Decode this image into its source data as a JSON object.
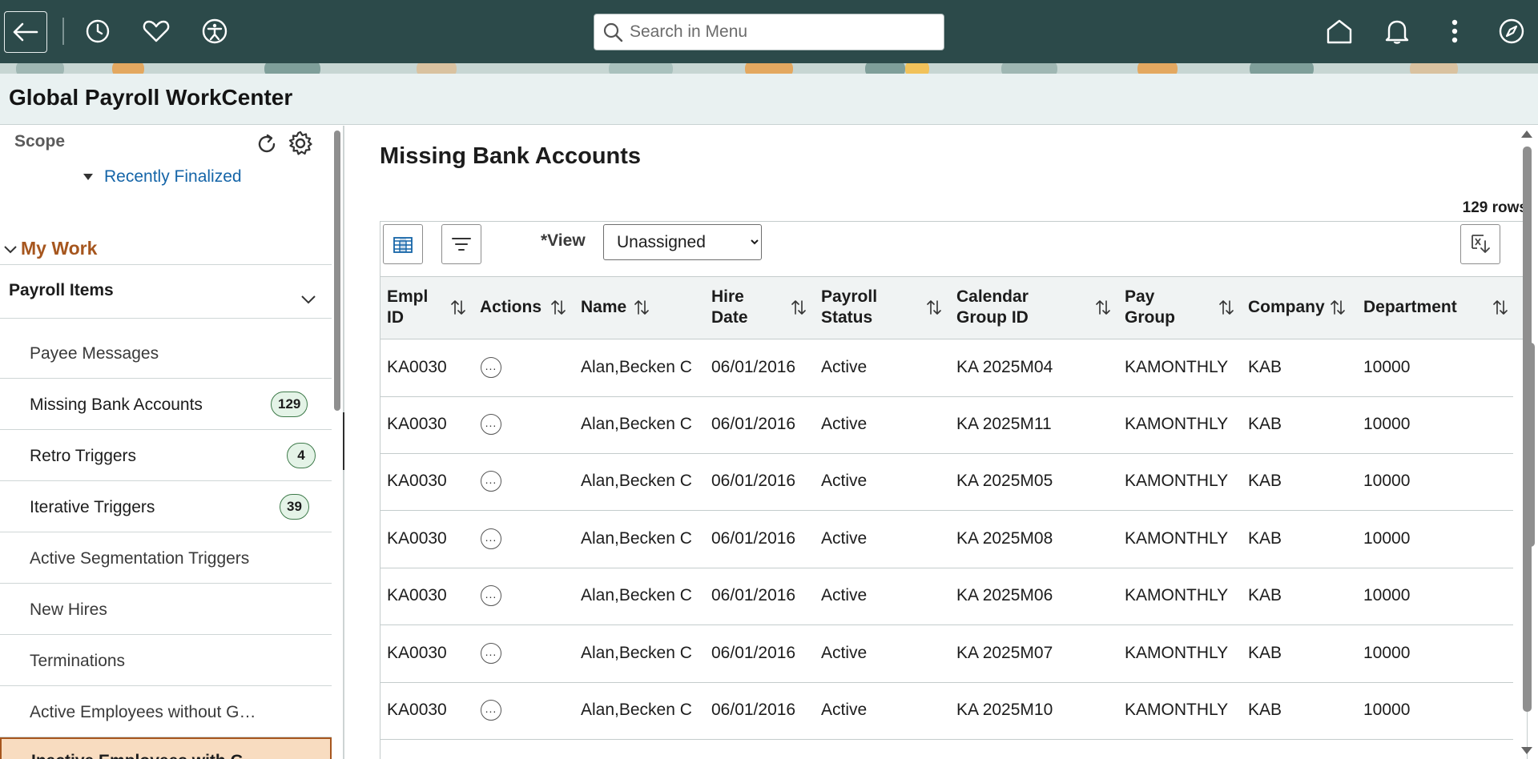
{
  "header": {
    "search_placeholder": "Search in Menu",
    "icons": [
      "back-icon",
      "history-icon",
      "favorites-icon",
      "accessibility-icon",
      "search-icon",
      "home-icon",
      "notifications-icon",
      "more-icon",
      "navigator-icon"
    ]
  },
  "page": {
    "title": "Global Payroll WorkCenter"
  },
  "left_panel": {
    "scope_label": "Scope",
    "recently_finalized": "Recently Finalized",
    "my_work": "My Work",
    "payroll_items": "Payroll Items",
    "items": [
      {
        "label": "Payee Messages",
        "badge": ""
      },
      {
        "label": "Missing Bank Accounts",
        "badge": "129"
      },
      {
        "label": "Retro Triggers",
        "badge": "4"
      },
      {
        "label": "Iterative Triggers",
        "badge": "39"
      },
      {
        "label": "Active Segmentation Triggers",
        "badge": ""
      },
      {
        "label": "New Hires",
        "badge": ""
      },
      {
        "label": "Terminations",
        "badge": ""
      },
      {
        "label": "Active Employees without G…",
        "badge": ""
      },
      {
        "label": "Inactive Employees with G…",
        "badge": ""
      }
    ]
  },
  "main": {
    "title": "Missing Bank Accounts",
    "row_count": "129 rows",
    "view_label": "*View",
    "view_value": "Unassigned",
    "columns": [
      {
        "line1": "Empl",
        "line2": "ID"
      },
      {
        "line1": "Actions",
        "line2": ""
      },
      {
        "line1": "Name",
        "line2": ""
      },
      {
        "line1": "Hire",
        "line2": "Date"
      },
      {
        "line1": "Payroll",
        "line2": "Status"
      },
      {
        "line1": "Calendar",
        "line2": "Group ID"
      },
      {
        "line1": "Pay",
        "line2": "Group"
      },
      {
        "line1": "Company",
        "line2": ""
      },
      {
        "line1": "Department",
        "line2": ""
      }
    ],
    "rows": [
      {
        "emplid": "KA0030",
        "name": "Alan,Becken C",
        "hire_date": "06/01/2016",
        "status": "Active",
        "cal_group": "KA 2025M04",
        "pay_group": "KAMONTHLY",
        "company": "KAB",
        "department": "10000"
      },
      {
        "emplid": "KA0030",
        "name": "Alan,Becken C",
        "hire_date": "06/01/2016",
        "status": "Active",
        "cal_group": "KA 2025M11",
        "pay_group": "KAMONTHLY",
        "company": "KAB",
        "department": "10000"
      },
      {
        "emplid": "KA0030",
        "name": "Alan,Becken C",
        "hire_date": "06/01/2016",
        "status": "Active",
        "cal_group": "KA 2025M05",
        "pay_group": "KAMONTHLY",
        "company": "KAB",
        "department": "10000"
      },
      {
        "emplid": "KA0030",
        "name": "Alan,Becken C",
        "hire_date": "06/01/2016",
        "status": "Active",
        "cal_group": "KA 2025M08",
        "pay_group": "KAMONTHLY",
        "company": "KAB",
        "department": "10000"
      },
      {
        "emplid": "KA0030",
        "name": "Alan,Becken C",
        "hire_date": "06/01/2016",
        "status": "Active",
        "cal_group": "KA 2025M06",
        "pay_group": "KAMONTHLY",
        "company": "KAB",
        "department": "10000"
      },
      {
        "emplid": "KA0030",
        "name": "Alan,Becken C",
        "hire_date": "06/01/2016",
        "status": "Active",
        "cal_group": "KA 2025M07",
        "pay_group": "KAMONTHLY",
        "company": "KAB",
        "department": "10000"
      },
      {
        "emplid": "KA0030",
        "name": "Alan,Becken C",
        "hire_date": "06/01/2016",
        "status": "Active",
        "cal_group": "KA 2025M10",
        "pay_group": "KAMONTHLY",
        "company": "KAB",
        "department": "10000"
      }
    ]
  },
  "colors": {
    "topbar": "#2c4a4a",
    "accent_orange": "#a6561e",
    "link_blue": "#1565a8",
    "badge_green": "#e4f3e7"
  }
}
